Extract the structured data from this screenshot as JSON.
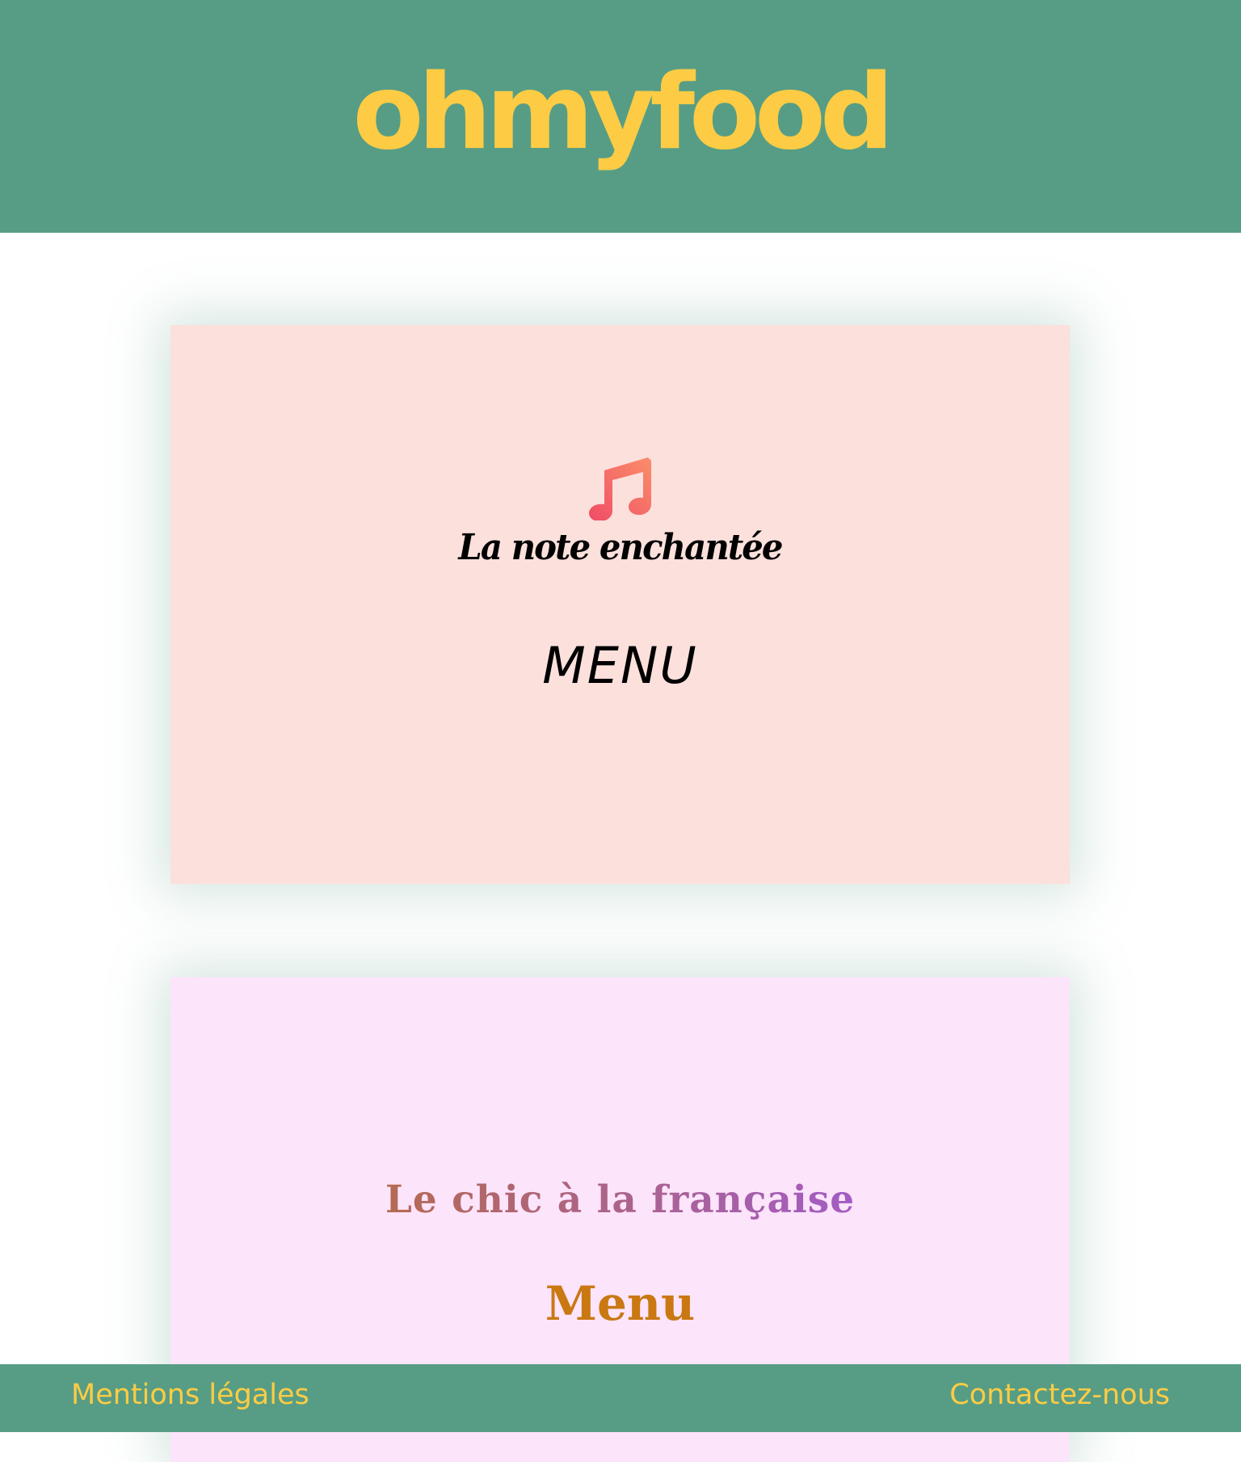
{
  "header": {
    "logo": "ohmyfood"
  },
  "restaurants": [
    {
      "icon": "music-note-icon",
      "name": "La note enchantée",
      "menu_label": "MENU",
      "background": "#fbe0dc"
    },
    {
      "name": "Le chic à la française",
      "menu_label": "Menu",
      "background": "#fce4fb"
    }
  ],
  "footer": {
    "legal_label": "Mentions légales",
    "contact_label": "Contactez-nous"
  },
  "colors": {
    "brand_green": "#579d85",
    "brand_yellow": "#fdcc44",
    "menu_orange": "#c97812"
  }
}
